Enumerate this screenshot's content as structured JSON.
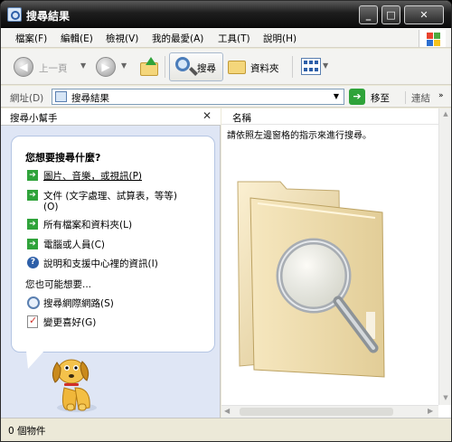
{
  "window": {
    "title": "搜尋結果"
  },
  "menu": [
    "檔案(F)",
    "編輯(E)",
    "檢視(V)",
    "我的最愛(A)",
    "工具(T)",
    "說明(H)"
  ],
  "toolbar": {
    "back": "上一頁",
    "search": "搜尋",
    "folders": "資料夾"
  },
  "address": {
    "label": "網址(D)",
    "value": "搜尋結果",
    "go": "移至",
    "links": "連結"
  },
  "leftpane": {
    "title": "搜尋小幫手",
    "question": "您想要搜尋什麼?",
    "options": [
      "圖片、音樂，或視訊(P)",
      "文件 (文字處理、試算表，等等)",
      "(O)",
      "所有檔案和資料夾(L)",
      "電腦或人員(C)"
    ],
    "help": "說明和支援中心裡的資訊(I)",
    "also": "您也可能想要...",
    "extra": [
      "搜尋網際網路(S)",
      "變更喜好(G)"
    ]
  },
  "rightpane": {
    "column": "名稱",
    "instruction": "請依照左邊窗格的指示來進行搜尋。"
  },
  "status": {
    "text": "0 個物件"
  }
}
